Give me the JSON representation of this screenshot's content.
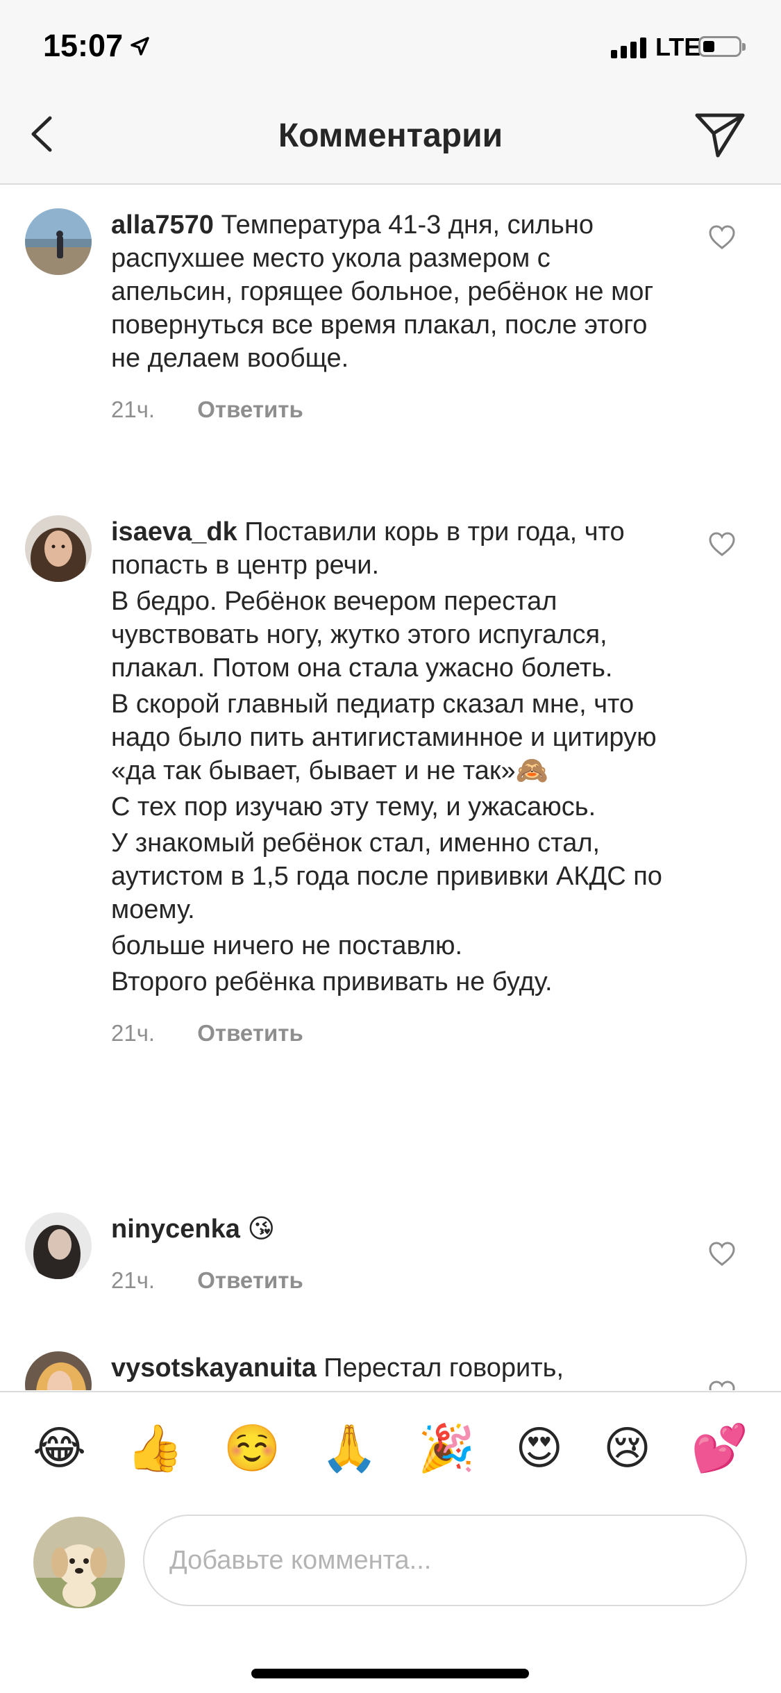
{
  "status_bar": {
    "time": "15:07",
    "network": "LTE"
  },
  "header": {
    "title": "Комментарии"
  },
  "comments": [
    {
      "username": "alla7570",
      "paragraphs": [
        "Температура 41-3 дня, сильно распухшее место укола размером с апельсин, горящее больное, ребёнок не мог повернуться все время плакал, после этого не делаем вообще."
      ],
      "time": "21ч.",
      "reply_label": "Ответить"
    },
    {
      "username": "isaeva_dk",
      "paragraphs": [
        "Поставили корь в три года, что попасть в центр речи.",
        "В бедро. Ребёнок вечером перестал чувствовать ногу, жутко этого испугался, плакал. Потом она стала ужасно болеть.",
        "В скорой главный педиатр сказал мне, что надо было пить антигистаминное и цитирую «да так бывает, бывает и не так»🙈",
        "С тех пор изучаю эту тему, и ужасаюсь.",
        "У знакомый ребёнок стал,  именно стал, аутистом в 1,5 года после прививки АКДС по моему.",
        "больше ничего не поставлю.",
        "Второго ребёнка прививать не буду."
      ],
      "time": "21ч.",
      "reply_label": "Ответить"
    },
    {
      "username": "ninycenka",
      "paragraphs": [
        "😘"
      ],
      "time": "21ч.",
      "reply_label": "Ответить"
    },
    {
      "username": "vysotskayanuita",
      "paragraphs": [
        "Перестал говорить,"
      ]
    }
  ],
  "emoji_bar": [
    "😂",
    "👍",
    "☺️",
    "🙏",
    "🎉",
    "😍",
    "😢",
    "💕"
  ],
  "composer": {
    "placeholder": "Добавьте коммента..."
  },
  "icons": {
    "back": "chevron-left-icon",
    "share": "paper-plane-icon",
    "like": "heart-outline-icon"
  }
}
